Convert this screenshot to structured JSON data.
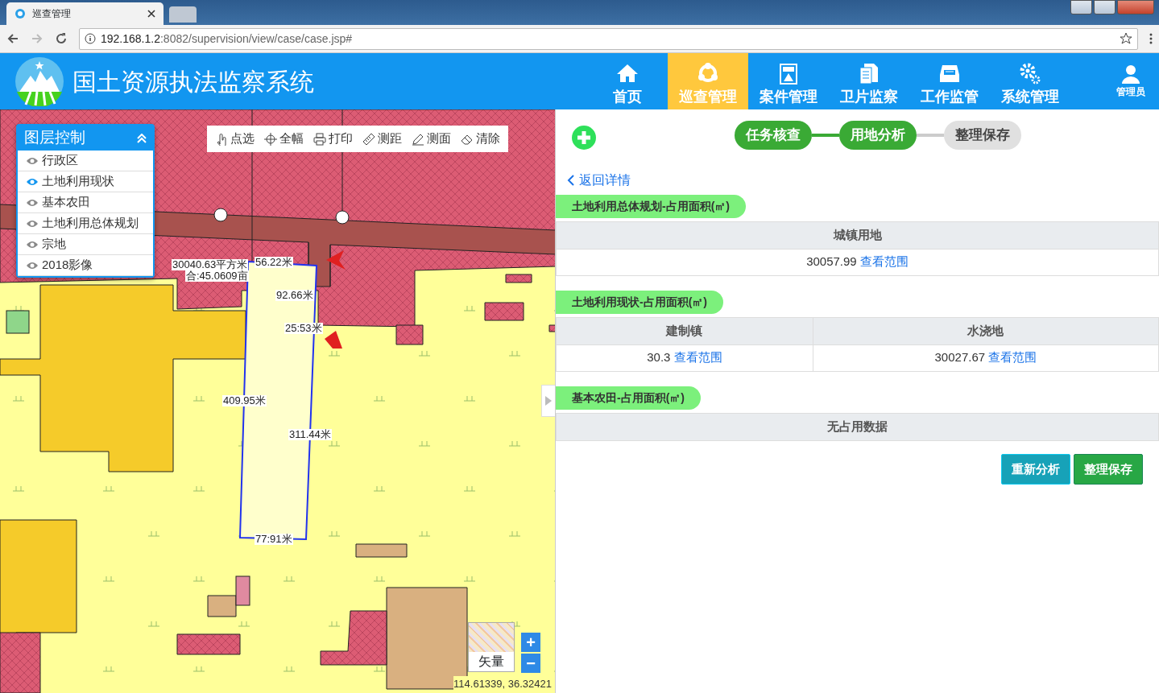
{
  "browser": {
    "tab_title": "巡查管理",
    "url_host": "192.168.1.2",
    "url_rest": ":8082/supervision/view/case/case.jsp#"
  },
  "app": {
    "title": "国土资源执法监察系统",
    "user": "管理员",
    "nav": [
      {
        "label": "首页",
        "selected": false,
        "kind": "home"
      },
      {
        "label": "巡查管理",
        "selected": true,
        "kind": "patrol"
      },
      {
        "label": "案件管理",
        "selected": false,
        "kind": "case"
      },
      {
        "label": "卫片监察",
        "selected": false,
        "kind": "docs"
      },
      {
        "label": "工作监管",
        "selected": false,
        "kind": "tray"
      },
      {
        "label": "系统管理",
        "selected": false,
        "kind": "gear"
      }
    ]
  },
  "map": {
    "layer_panel": {
      "title": "图层控制",
      "layers": [
        {
          "label": "行政区",
          "visible": false
        },
        {
          "label": "土地利用现状",
          "visible": true
        },
        {
          "label": "基本农田",
          "visible": false
        },
        {
          "label": "土地利用总体规划",
          "visible": false
        },
        {
          "label": "宗地",
          "visible": false
        },
        {
          "label": "2018影像",
          "visible": false
        }
      ]
    },
    "toolbar": [
      {
        "label": "点选",
        "kind": "hand"
      },
      {
        "label": "全幅",
        "kind": "target"
      },
      {
        "label": "打印",
        "kind": "print"
      },
      {
        "label": "测距",
        "kind": "ruler"
      },
      {
        "label": "测面",
        "kind": "area"
      },
      {
        "label": "清除",
        "kind": "eraser"
      }
    ],
    "measure_labels": [
      "30040.63平方米",
      "合:45.0609亩",
      "56.22米",
      "92.66米",
      "25:53米",
      "409.95米",
      "311.44米",
      "77:91米"
    ],
    "basemap_label": "矢量",
    "zoom_in": "+",
    "zoom_out": "−",
    "coordinates": "114.61339, 36.32421"
  },
  "panel": {
    "steps": [
      {
        "label": "任务核查",
        "done": true
      },
      {
        "label": "用地分析",
        "done": true
      },
      {
        "label": "整理保存",
        "done": false
      }
    ],
    "back_link": "返回详情",
    "sections": [
      {
        "title": "土地利用总体规划-占用面积(㎡)",
        "columns": [
          "城镇用地"
        ],
        "cells": [
          {
            "value": "30057.99",
            "link": "查看范围"
          }
        ]
      },
      {
        "title": "土地利用现状-占用面积(㎡)",
        "columns": [
          "建制镇",
          "水浇地"
        ],
        "cells": [
          {
            "value": "30.3",
            "link": "查看范围"
          },
          {
            "value": "30027.67",
            "link": "查看范围"
          }
        ]
      },
      {
        "title": "基本农田-占用面积(㎡)",
        "columns": [
          "无占用数据"
        ]
      }
    ],
    "buttons": [
      {
        "label": "重新分析",
        "kind": "info"
      },
      {
        "label": "整理保存",
        "kind": "success"
      }
    ]
  }
}
